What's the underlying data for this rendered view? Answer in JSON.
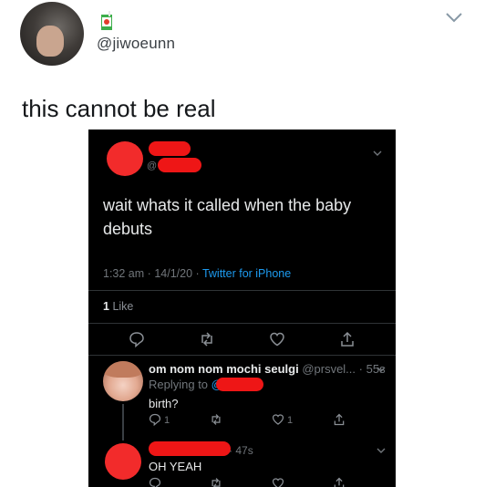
{
  "outer_tweet": {
    "handle": "@jiwoeunn",
    "text": "this cannot be real",
    "icons": [
      "juice-box-icon",
      "chevron-down-icon"
    ]
  },
  "screenshot": {
    "main_tweet": {
      "text": "wait whats it called when the baby debuts",
      "time": "1:32 am",
      "date": "14/1/20",
      "source": "Twitter for iPhone",
      "likes_count": "1",
      "likes_label": "Like",
      "sep": "·"
    },
    "reply1": {
      "name": "om nom nom mochi seulgi",
      "handle": "@prsvel...",
      "time": "55s",
      "sep": "·",
      "replying_label": "Replying to",
      "replying_at": "@",
      "text": "birth?",
      "reply_count": "1",
      "like_count": "1"
    },
    "reply2": {
      "time": "47s",
      "sep": "·",
      "text": "OH YEAH"
    }
  },
  "colors": {
    "accent": "#1d9bf0",
    "redaction": "#ee1616",
    "dark_bg": "#000000"
  }
}
